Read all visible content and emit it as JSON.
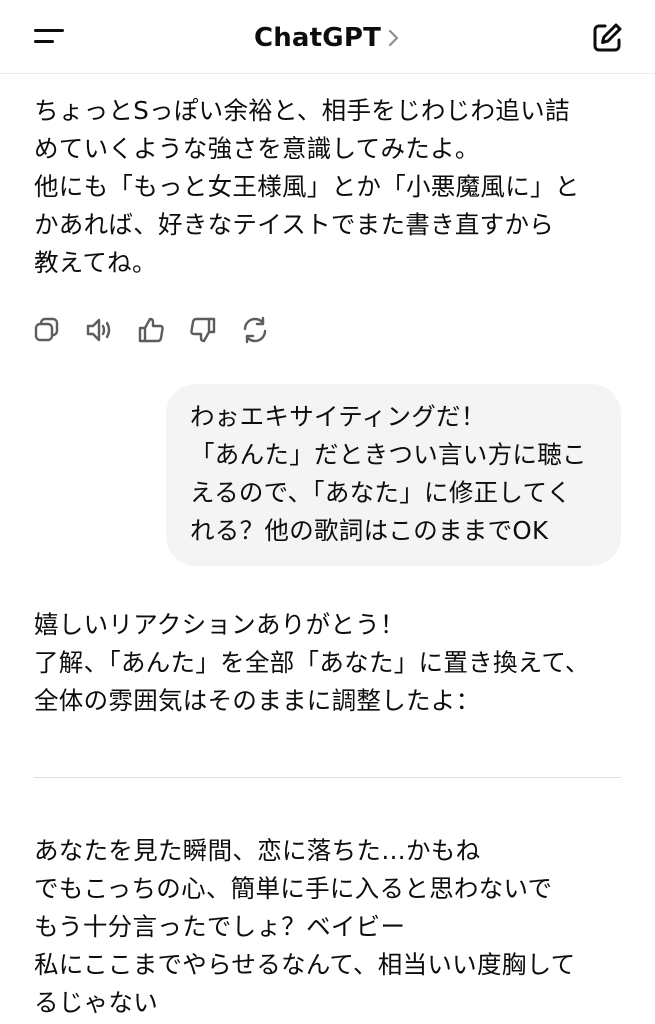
{
  "header": {
    "title": "ChatGPT",
    "icons": {
      "menu": "hamburger-menu-icon",
      "chevron": "chevron-right-icon",
      "new_chat": "compose-icon"
    }
  },
  "messages": [
    {
      "role": "assistant",
      "lines": [
        "ちょっとSっぽい余裕と、相手をじわじわ追い詰",
        "めていくような強さを意識してみたよ。",
        "他にも「もっと女王様風」とか「小悪魔風に」と",
        "かあれば、好きなテイストでまた書き直すから",
        "教えてね。"
      ]
    },
    {
      "role": "user",
      "lines": [
        "わぉエキサイティングだ！",
        "「あんた」だときつい言い方に聴こ",
        "えるので、「あなた」に修正してく",
        "れる？他の歌詞はこのままでOK"
      ]
    },
    {
      "role": "assistant",
      "lines": [
        "嬉しいリアクションありがとう！",
        "了解、「あんた」を全部「あなた」に置き換えて、",
        "全体の雰囲気はそのままに調整したよ："
      ]
    },
    {
      "role": "assistant",
      "lines": [
        "あなたを見た瞬間、恋に落ちた…かもね",
        "でもこっちの心、簡単に手に入ると思わないで",
        "もう十分言ったでしょ？ベイビー",
        "私にここまでやらせるなんて、相当いい度胸して",
        "るじゃない"
      ]
    }
  ],
  "action_icons": [
    "copy-icon",
    "read-aloud-icon",
    "thumbs-up-icon",
    "thumbs-down-icon",
    "regenerate-icon"
  ],
  "colors": {
    "text": "#0d0d0d",
    "icon": "#5d5d5d",
    "bubble": "#f4f4f4",
    "divider": "#dedede"
  }
}
